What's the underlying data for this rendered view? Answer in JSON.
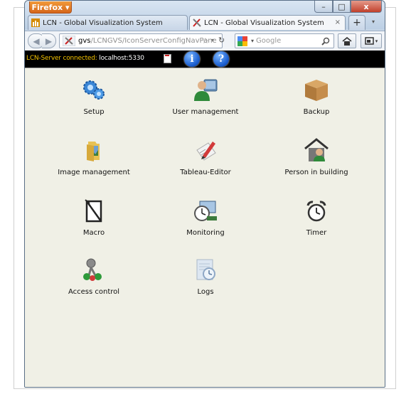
{
  "browser": {
    "menu_button": "Firefox",
    "window_controls": {
      "minimize": "–",
      "maximize": "□",
      "close": "x"
    }
  },
  "tabs": [
    {
      "label": "LCN - Global Visualization System",
      "active": false
    },
    {
      "label": "LCN - Global Visualization System",
      "active": true,
      "close": "×"
    }
  ],
  "new_tab": "+",
  "navbar": {
    "url_domain": "gvs",
    "url_path": "/LCNGVS/IconServerConfigNavPane",
    "search_placeholder": "Google"
  },
  "lcn_bar": {
    "connection_label": "LCN-Server connected:",
    "host": "localhost:5330",
    "info_button": "i",
    "help_button": "?"
  },
  "menu": [
    {
      "label": "Setup",
      "icon": "gears-icon"
    },
    {
      "label": "User management",
      "icon": "user-icon"
    },
    {
      "label": "Backup",
      "icon": "box-icon"
    },
    {
      "label": "Image management",
      "icon": "folder-icon"
    },
    {
      "label": "Tableau-Editor",
      "icon": "pencil-icon"
    },
    {
      "label": "Person in building",
      "icon": "house-person-icon"
    },
    {
      "label": "Macro",
      "icon": "macro-icon"
    },
    {
      "label": "Monitoring",
      "icon": "monitoring-icon"
    },
    {
      "label": "Timer",
      "icon": "alarm-clock-icon"
    },
    {
      "label": "Access control",
      "icon": "keys-icon"
    },
    {
      "label": "Logs",
      "icon": "logs-icon"
    }
  ]
}
